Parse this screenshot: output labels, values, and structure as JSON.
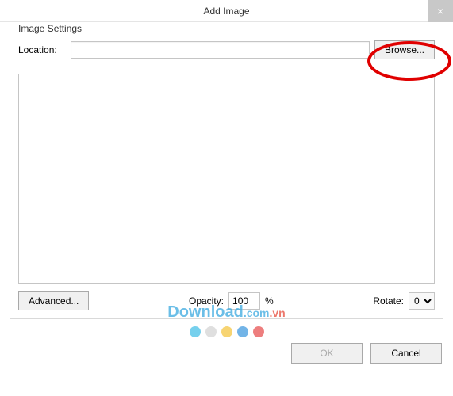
{
  "window": {
    "title": "Add Image",
    "close": "×"
  },
  "fieldset": {
    "legend": "Image Settings",
    "location_label": "Location:",
    "location_value": "",
    "browse_btn": "Browse...",
    "advanced_btn": "Advanced...",
    "opacity_label": "Opacity:",
    "opacity_value": "100",
    "opacity_unit": "%",
    "rotate_label": "Rotate:",
    "rotate_value": "0"
  },
  "footer": {
    "ok": "OK",
    "cancel": "Cancel"
  },
  "watermark": {
    "text_front": "Download",
    "text_com": ".com",
    "text_vn": ".vn"
  }
}
